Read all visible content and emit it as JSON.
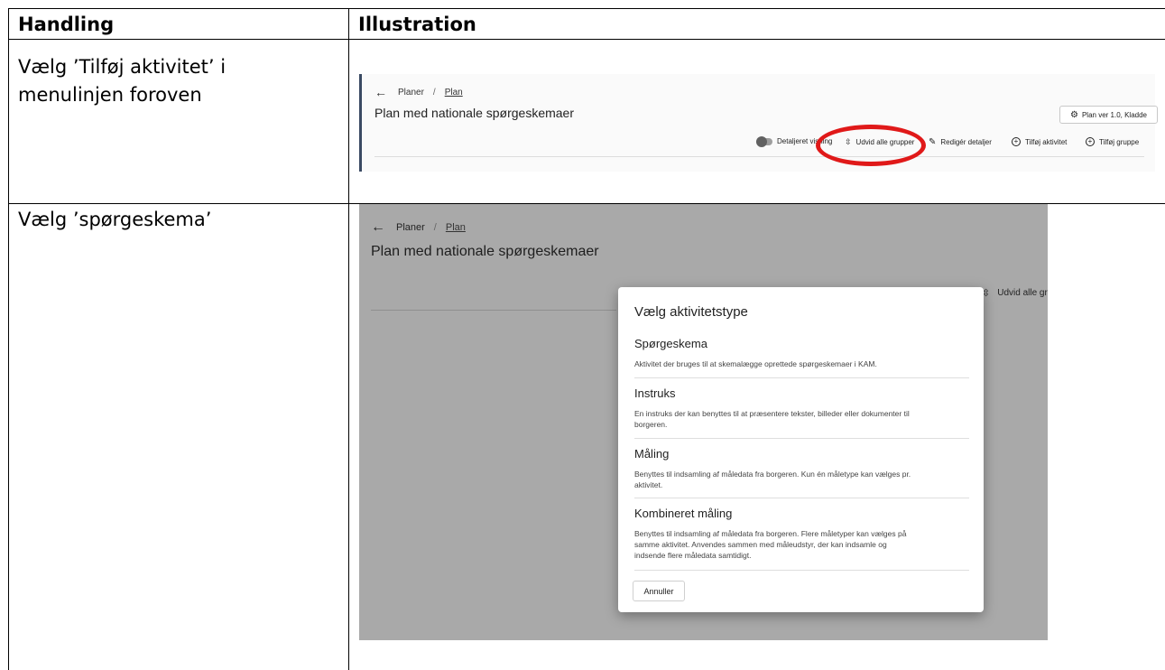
{
  "table": {
    "headers": {
      "handling": "Handling",
      "illustration": "Illustration"
    },
    "rows": [
      {
        "handling_line1": "Vælg ’Tilføj aktivitet’ i",
        "handling_line2": "menulinjen foroven"
      },
      {
        "handling": "Vælg ’spørgeskema’"
      }
    ]
  },
  "screenshot1": {
    "breadcrumb": {
      "parent": "Planer",
      "separator": "/",
      "current": "Plan"
    },
    "title": "Plan med nationale spørgeskemaer",
    "version_button": "Plan ver 1.0, Kladde",
    "toolbar": {
      "detailed_view": "Detaljeret visning",
      "expand_groups": "Udvid alle grupper",
      "edit_details": "Redigér detaljer",
      "add_activity": "Tilføj aktivitet",
      "add_group": "Tilføj gruppe"
    },
    "highlight_color": "#e01919"
  },
  "screenshot2": {
    "breadcrumb": {
      "parent": "Planer",
      "separator": "/",
      "current": "Plan"
    },
    "title": "Plan med nationale spørgeskemaer",
    "background_toolbar": {
      "expand_groups": "Udvid alle gr"
    },
    "dialog": {
      "title": "Vælg aktivitetstype",
      "options": [
        {
          "title": "Spørgeskema",
          "desc_lines": [
            "Aktivitet der bruges til at skemalægge oprettede spørgeskemaer i KAM."
          ]
        },
        {
          "title": "Instruks",
          "desc_lines": [
            "En instruks der kan benyttes til at præsentere tekster, billeder eller dokumenter til",
            "borgeren."
          ]
        },
        {
          "title": "Måling",
          "desc_lines": [
            "Benyttes til indsamling af måledata fra borgeren. Kun én måletype kan vælges pr.",
            "aktivitet."
          ]
        },
        {
          "title": "Kombineret måling",
          "desc_lines": [
            "Benyttes til indsamling af måledata fra borgeren. Flere måletyper kan vælges på",
            "samme aktivitet. Anvendes sammen med måleudstyr, der kan indsamle og",
            "indsende flere måledata samtidigt."
          ]
        }
      ],
      "cancel_button": "Annuller"
    }
  }
}
